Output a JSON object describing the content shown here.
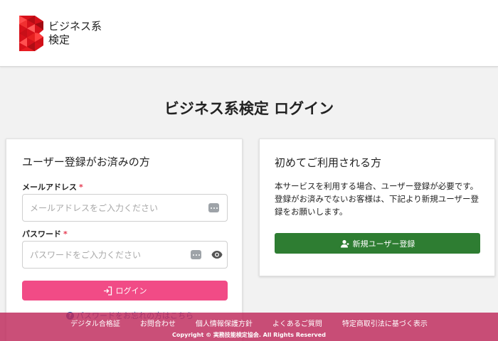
{
  "header": {
    "logo_line1": "ビジネス系",
    "logo_line2": "検定"
  },
  "page_title": "ビジネス系検定 ログイン",
  "login_card": {
    "title": "ユーザー登録がお済みの方",
    "email_label": "メールアドレス",
    "email_placeholder": "メールアドレスをご入力ください",
    "password_label": "パスワード",
    "password_placeholder": "パスワードをご入力ください",
    "required_mark": "*",
    "login_button": "ログイン",
    "forgot_link": "パスワードをお忘れの方はこちら"
  },
  "register_card": {
    "title": "初めてご利用される方",
    "description": "本サービスを利用する場合、ユーザー登録が必要です。 登録がお済みでないお客様は、下記より新規ユーザー登録をお願いします。",
    "register_button": "新規ユーザー登録"
  },
  "footer": {
    "links": [
      "デジタル合格証",
      "お問合わせ",
      "個人情報保護方針",
      "よくあるご質問",
      "特定商取引法に基づく表示"
    ],
    "copyright": "Copyright © 実務技能検定協会. All Rights Reserved"
  },
  "colors": {
    "login_button": "#f14b86",
    "register_button": "#2e7d32",
    "footer": "#be285a",
    "required": "#e53950"
  }
}
